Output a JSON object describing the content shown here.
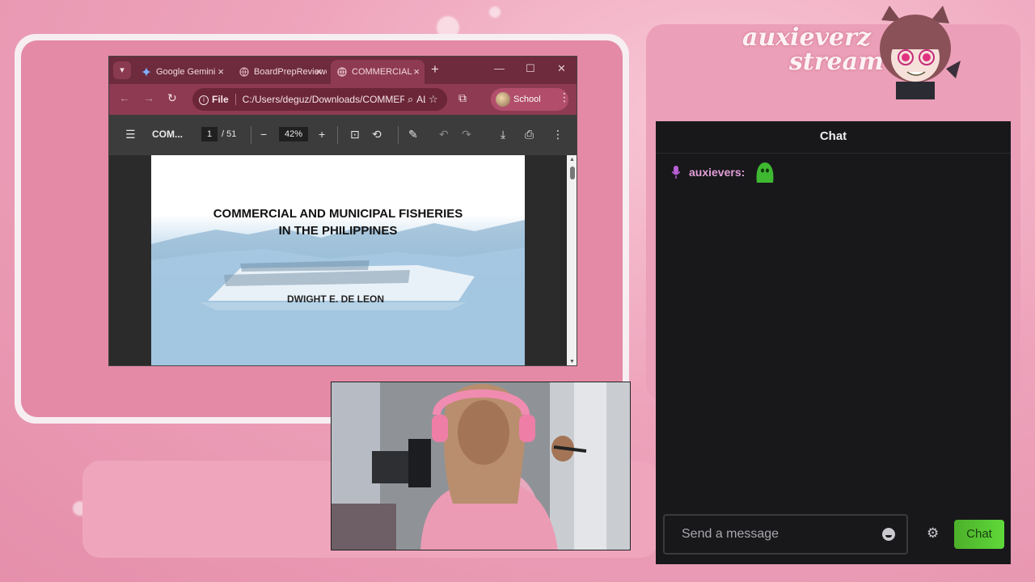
{
  "stream": {
    "brand_line1": "auxieverz",
    "brand_line2": "stream"
  },
  "browser": {
    "tabs": [
      {
        "label": "Google Gemini",
        "favicon": "gemini-icon"
      },
      {
        "label": "BoardPrepReviewer",
        "favicon": "globe-icon"
      },
      {
        "label": "COMMERCIAL",
        "favicon": "globe-icon",
        "active": true
      }
    ],
    "address": {
      "scheme_label": "File",
      "url": "C:/Users/deguz/Downloads/COMMERCIAL"
    },
    "profile_label": "School"
  },
  "pdf": {
    "doc_title": "COM...",
    "current_page": "1",
    "page_count": "/ 51",
    "zoom": "42%",
    "content": {
      "title_line1": "COMMERCIAL AND MUNICIPAL FISHERIES",
      "title_line2": "IN THE PHILIPPINES",
      "author": "DWIGHT E. DE LEON"
    }
  },
  "chat": {
    "header": "Chat",
    "messages": [
      {
        "user": "auxievers:",
        "emote": "green-blob-emote"
      }
    ],
    "input_placeholder": "Send a message",
    "send_label": "Chat"
  }
}
